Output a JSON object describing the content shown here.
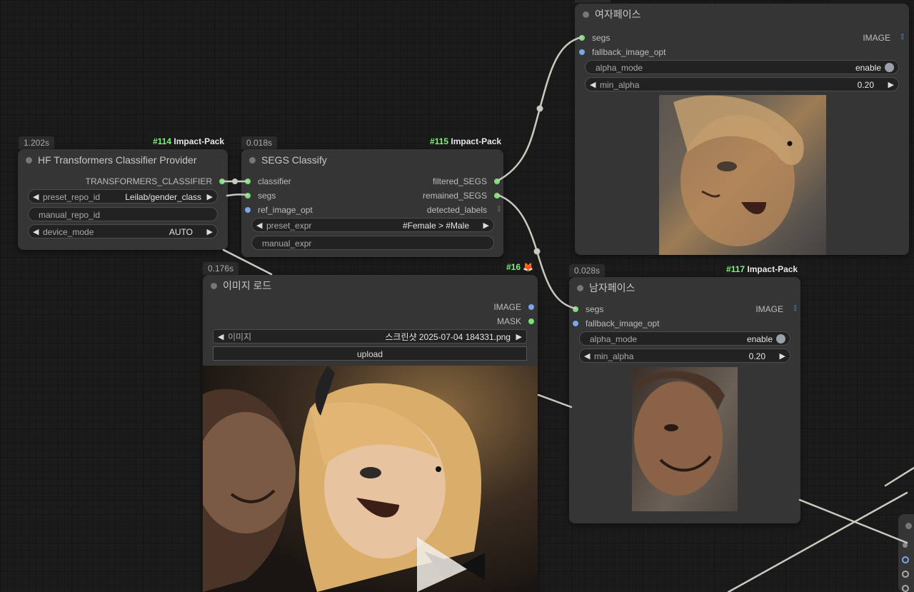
{
  "nodes": {
    "hf": {
      "time": "1.202s",
      "pack_id": "#114",
      "pack_name": "Impact-Pack",
      "title": "HF Transformers Classifier Provider",
      "output": "TRANSFORMERS_CLASSIFIER",
      "preset_repo_id": {
        "label": "preset_repo_id",
        "value": "Leilab/gender_class"
      },
      "manual_repo_id": {
        "label": "manual_repo_id"
      },
      "device_mode": {
        "label": "device_mode",
        "value": "AUTO"
      }
    },
    "segs": {
      "time": "0.018s",
      "pack_id": "#115",
      "pack_name": "Impact-Pack",
      "title": "SEGS Classify",
      "inputs": [
        "classifier",
        "segs",
        "ref_image_opt"
      ],
      "outputs": [
        "filtered_SEGS",
        "remained_SEGS",
        "detected_labels"
      ],
      "preset_expr": {
        "label": "preset_expr",
        "value": "#Female > #Male"
      },
      "manual_expr": {
        "label": "manual_expr"
      }
    },
    "female": {
      "title": "여자페이스",
      "inputs": [
        "segs",
        "fallback_image_opt"
      ],
      "output": "IMAGE",
      "alpha_mode": {
        "label": "alpha_mode",
        "value": "enable"
      },
      "min_alpha": {
        "label": "min_alpha",
        "value": "0.20"
      }
    },
    "load": {
      "time": "0.176s",
      "pack_id": "#16",
      "title": "이미지 로드",
      "outputs": [
        "IMAGE",
        "MASK"
      ],
      "image": {
        "label": "이미지",
        "value": "스크린샷 2025-07-04 184331.png"
      },
      "upload_label": "upload"
    },
    "male": {
      "time": "0.028s",
      "pack_id": "#117",
      "pack_name": "Impact-Pack",
      "title": "남자페이스",
      "inputs": [
        "segs",
        "fallback_image_opt"
      ],
      "output": "IMAGE",
      "alpha_mode": {
        "label": "alpha_mode",
        "value": "enable"
      },
      "min_alpha": {
        "label": "min_alpha",
        "value": "0.20"
      }
    }
  },
  "icons": {
    "wire_dot": "reroute-dot-icon",
    "fox": "fox-icon",
    "image_grid": "grid-list-icon"
  },
  "colors": {
    "port_green": "#7be07b",
    "port_blue": "#7aa7e8",
    "wire": "#c9c9c0",
    "node_bg": "#353535",
    "canvas_bg": "#1b1b1b",
    "pack_hash": "#7ff07f"
  }
}
